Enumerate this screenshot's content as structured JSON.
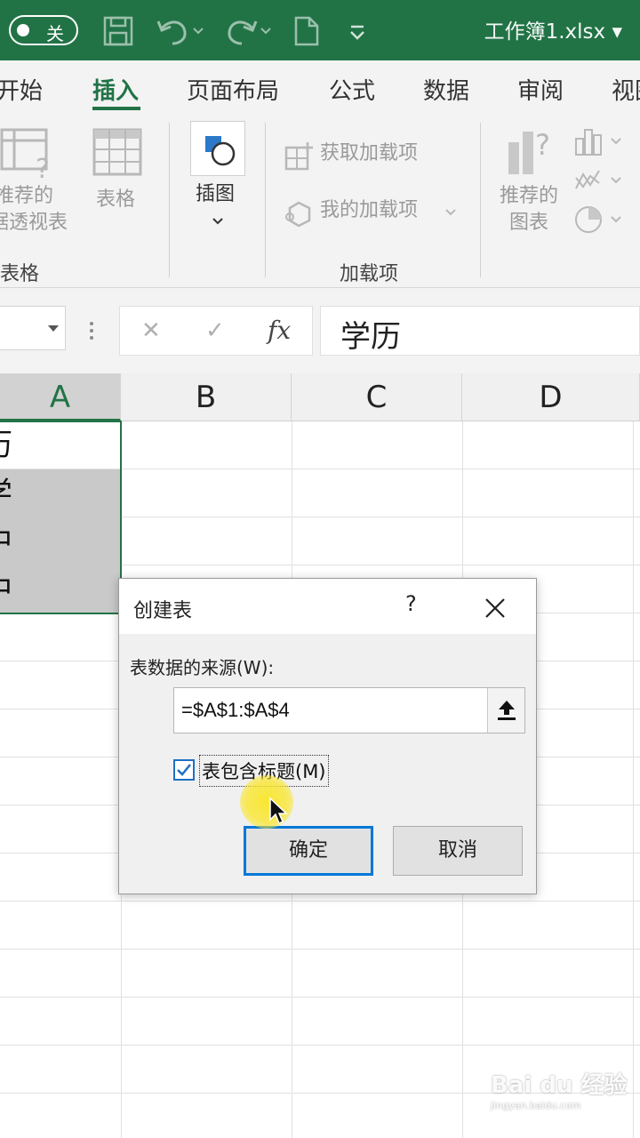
{
  "titlebar": {
    "autosave_label": "关",
    "doc_title": "工作簿1.xlsx ▾"
  },
  "tabs": [
    "开始",
    "插入",
    "页面布局",
    "公式",
    "数据",
    "审阅",
    "视图"
  ],
  "active_tab": "插入",
  "ribbon": {
    "pivot_label_1": "推荐的",
    "pivot_label_2": "据透视表",
    "table_label": "表格",
    "illustration_label": "插图",
    "get_addins_label": "获取加载项",
    "my_addins_label": "我的加载项",
    "rec_chart_label_1": "推荐的",
    "rec_chart_label_2": "图表",
    "group_tables": "表格",
    "group_addins": "加载项"
  },
  "formula_bar": {
    "cancel_symbol": "✕",
    "enter_symbol": "✓",
    "fx_label": "fx",
    "content": "学历"
  },
  "columns": [
    "A",
    "B",
    "C",
    "D"
  ],
  "cells": [
    "历",
    "学",
    "中",
    "中"
  ],
  "dialog": {
    "title": "创建表",
    "help": "?",
    "source_label": "表数据的来源(W):",
    "range_value": "=$A$1:$A$4",
    "checkbox_label": "表包含标题(M)",
    "checkbox_checked": true,
    "ok_label": "确定",
    "cancel_label": "取消"
  },
  "watermark": {
    "brand": "Bai du 经验",
    "url": "jingyan.baidu.com"
  }
}
